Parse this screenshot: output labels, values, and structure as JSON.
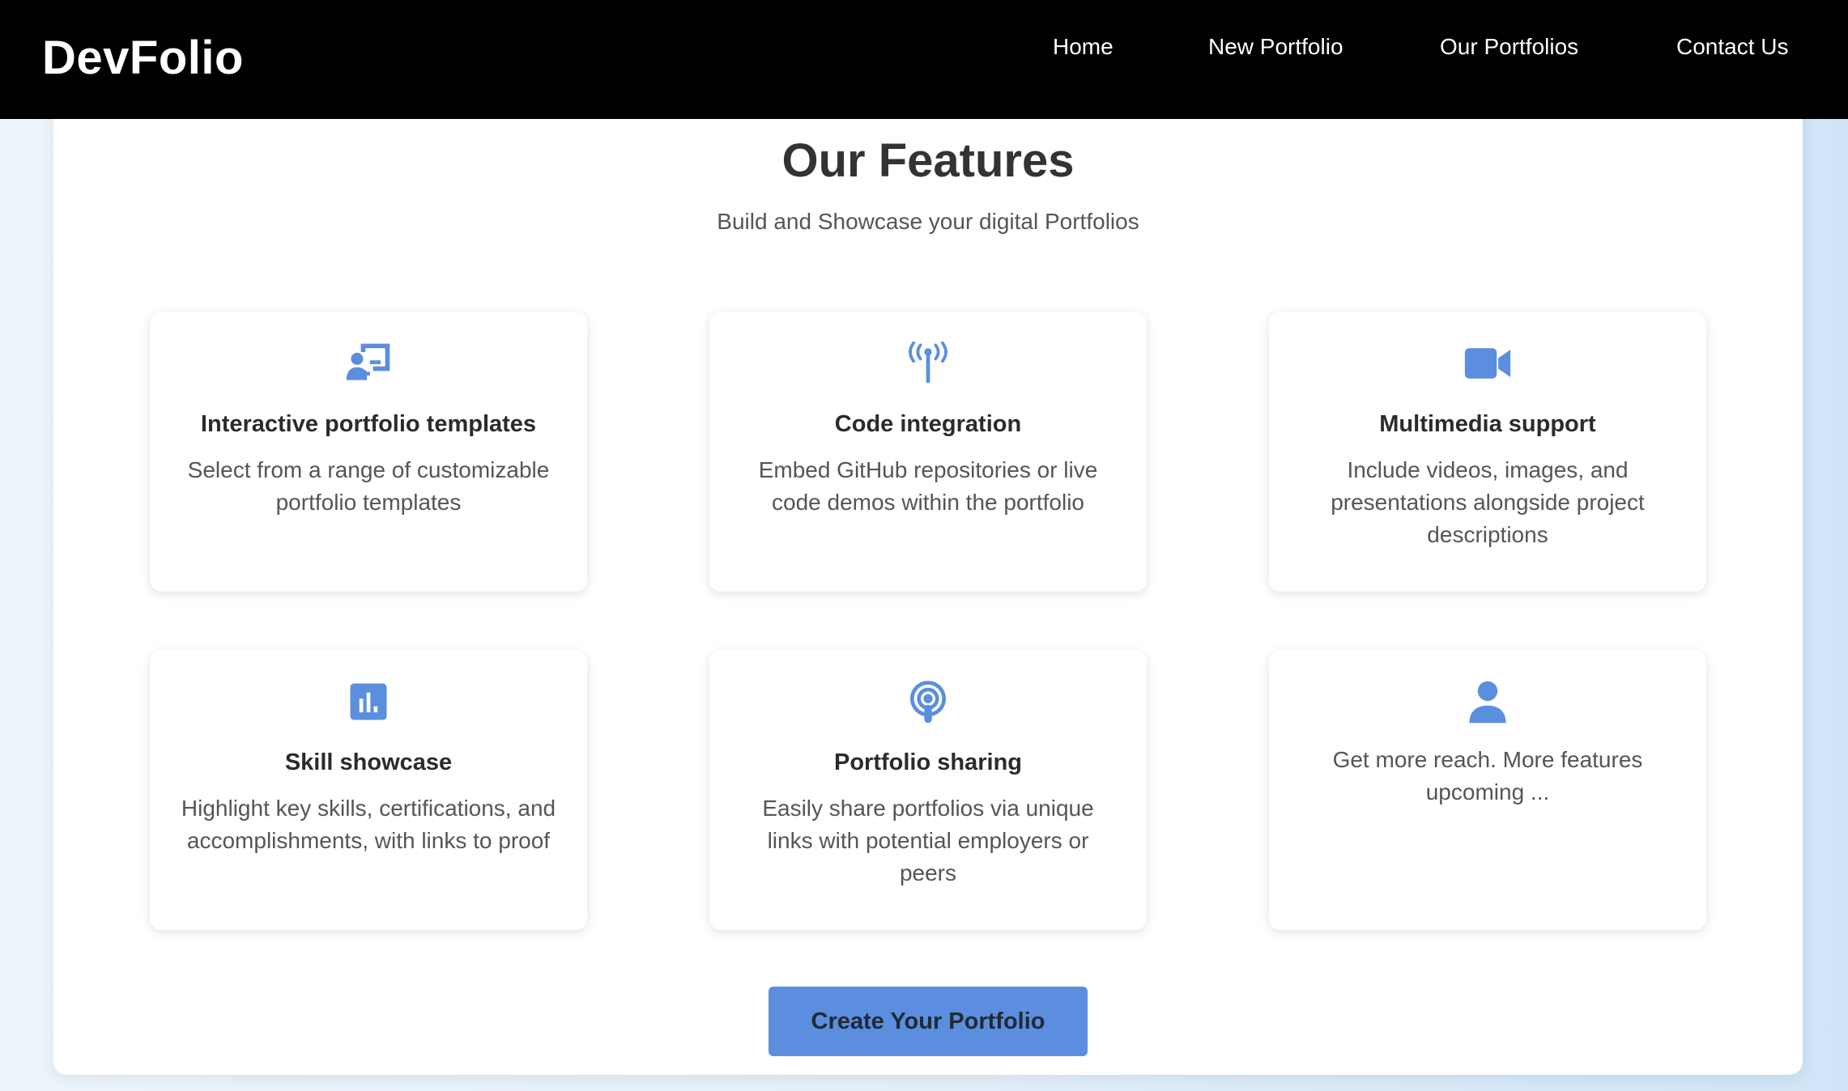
{
  "navbar": {
    "brand": "DevFolio",
    "links": [
      "Home",
      "New Portfolio",
      "Our Portfolios",
      "Contact Us"
    ]
  },
  "features": {
    "title": "Our Features",
    "subtitle": "Build and Showcase your digital Portfolios",
    "accent_color": "#5b8ede",
    "cards": [
      {
        "icon": "presentation-user-icon",
        "title": "Interactive portfolio templates",
        "description": "Select from a range of customizable portfolio templates"
      },
      {
        "icon": "antenna-icon",
        "title": "Code integration",
        "description": "Embed GitHub repositories or live code demos within the portfolio"
      },
      {
        "icon": "video-camera-icon",
        "title": "Multimedia support",
        "description": "Include videos, images, and presentations alongside project descriptions"
      },
      {
        "icon": "bar-chart-icon",
        "title": "Skill showcase",
        "description": "Highlight key skills, certifications, and accomplishments, with links to proof"
      },
      {
        "icon": "podcast-icon",
        "title": "Portfolio sharing",
        "description": "Easily share portfolios via unique links with potential employers or peers"
      },
      {
        "icon": "person-icon",
        "title": "",
        "description": "Get more reach. More features upcoming ..."
      }
    ],
    "cta_label": "Create Your Portfolio"
  }
}
